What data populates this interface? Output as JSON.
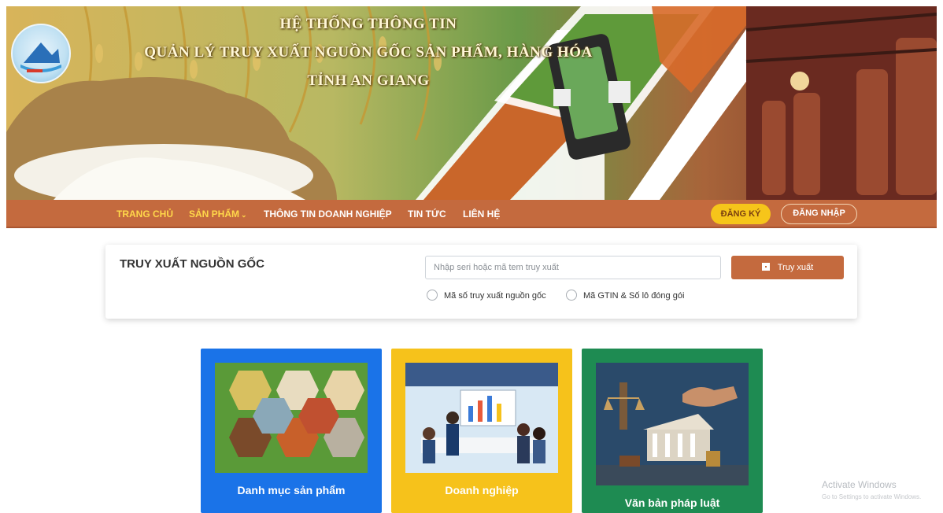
{
  "banner": {
    "title_line1": "HỆ THỐNG THÔNG TIN",
    "title_line2": "QUẢN LÝ TRUY XUẤT NGUỒN GỐC SẢN PHẨM, HÀNG HÓA",
    "title_line3": "TỈNH AN GIANG",
    "logo_icon": "an-giang-logo-icon"
  },
  "nav": {
    "home": "TRANG CHỦ",
    "products": "SẢN PHẨM",
    "products_chevron": "⌄",
    "company": "THÔNG TIN DOANH NGHIỆP",
    "news": "TIN TỨC",
    "contact": "LIÊN HỆ",
    "register": "ĐĂNG KÝ",
    "login": "ĐĂNG NHẬP"
  },
  "search": {
    "title": "TRUY XUẤT NGUỒN GỐC",
    "placeholder": "Nhập seri hoặc mã tem truy xuất",
    "button": "Truy xuất",
    "option1": "Mã số truy xuất nguồn gốc",
    "option2": "Mã GTIN & Số lô đóng gói"
  },
  "cards": [
    {
      "label": "Danh mục sản phẩm"
    },
    {
      "label": "Doanh nghiệp"
    },
    {
      "label": "Văn bản pháp luật"
    }
  ],
  "watermark": {
    "line1": "Activate Windows",
    "line2": "Go to Settings to activate Windows."
  },
  "colors": {
    "nav_bg": "#c46a3e",
    "nav_active": "#ffd84a",
    "register_bg": "#f6c51a",
    "card_blue": "#1a73e8",
    "card_yellow": "#f6c21b",
    "card_green": "#1e8b52"
  }
}
